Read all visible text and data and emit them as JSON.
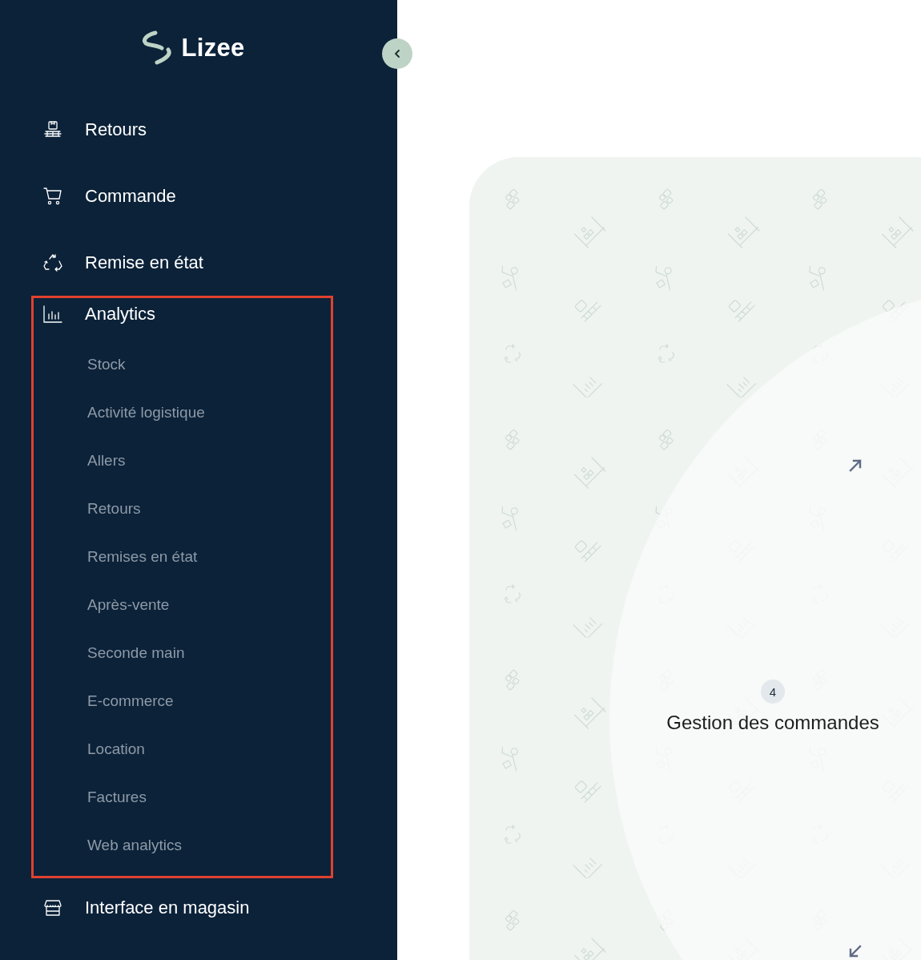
{
  "logo": {
    "text": "Lizee"
  },
  "sidebar": {
    "collapsed": false,
    "items": [
      {
        "label": "Retours"
      },
      {
        "label": "Commande"
      },
      {
        "label": "Remise en état"
      },
      {
        "label": "Analytics",
        "expanded": true,
        "highlighted": true,
        "children": [
          {
            "label": "Stock"
          },
          {
            "label": "Activité logistique"
          },
          {
            "label": "Allers"
          },
          {
            "label": "Retours"
          },
          {
            "label": "Remises en état"
          },
          {
            "label": "Après-vente"
          },
          {
            "label": "Seconde main"
          },
          {
            "label": "E-commerce"
          },
          {
            "label": "Location"
          },
          {
            "label": "Factures"
          },
          {
            "label": "Web analytics"
          }
        ]
      },
      {
        "label": "Interface en magasin"
      }
    ]
  },
  "card": {
    "step": "4",
    "title": "Gestion des commandes"
  }
}
